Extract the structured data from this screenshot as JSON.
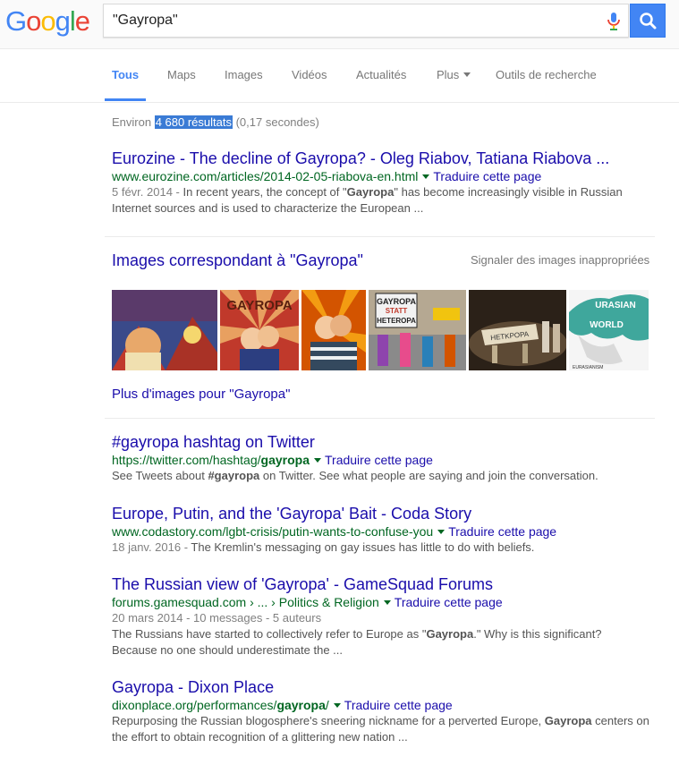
{
  "header": {
    "logo_letters": [
      "G",
      "o",
      "o",
      "g",
      "l",
      "e"
    ],
    "logo_colors": [
      "#4285f4",
      "#ea4335",
      "#fbbc05",
      "#4285f4",
      "#34a853",
      "#ea4335"
    ],
    "query": "\"Gayropa\"",
    "accent": "#4285f4",
    "mic_icon": "microphone-icon",
    "search_icon": "magnifier-icon"
  },
  "tabs": [
    {
      "label": "Tous",
      "active": true
    },
    {
      "label": "Maps"
    },
    {
      "label": "Images"
    },
    {
      "label": "Vidéos"
    },
    {
      "label": "Actualités"
    },
    {
      "label": "Plus"
    },
    {
      "label": "Outils de recherche"
    }
  ],
  "stats": {
    "prefix": "Environ ",
    "highlight": "4 680 résultats",
    "suffix": " (0,17 secondes)"
  },
  "results": [
    {
      "title": "Eurozine - The decline of Gayropa? - Oleg Riabov, Tatiana Riabova ...",
      "url": "www.eurozine.com/articles/2014-02-05-riabova-en.html",
      "translate": "Traduire cette page",
      "date": "5 févr. 2014 - ",
      "snippet_1": "In recent years, the concept of \"",
      "snippet_b": "Gayropa",
      "snippet_2": "\" has become increasingly visible in Russian",
      "snippet_line2": "Internet sources and is used to characterize the European ..."
    },
    {
      "title": "#gayropa hashtag on Twitter",
      "url_pre": "https://twitter.com/hashtag/",
      "url_b": "gayropa",
      "translate": "Traduire cette page",
      "snippet_1": "See Tweets about ",
      "snippet_b": "#gayropa",
      "snippet_2": " on Twitter. See what people are saying and join the conversation."
    },
    {
      "title": "Europe, Putin, and the 'Gayropa' Bait - Coda Story",
      "url": "www.codastory.com/lgbt-crisis/putin-wants-to-confuse-you",
      "translate": "Traduire cette page",
      "date": "18 janv. 2016 - ",
      "snippet": "The Kremlin's messaging on gay issues has little to do with beliefs."
    },
    {
      "title": "The Russian view of 'Gayropa' - GameSquad Forums",
      "url": "forums.gamesquad.com › ... › Politics & Religion",
      "translate": "Traduire cette page",
      "meta": "20 mars 2014 - 10 messages - 5 auteurs",
      "snippet_1": "The Russians have started to collectively refer to Europe as \"",
      "snippet_b": "Gayropa",
      "snippet_2": ".\" Why is this significant?",
      "snippet_line2": "Because no one should underestimate the ..."
    },
    {
      "title": "Gayropa - Dixon Place",
      "url_pre": "dixonplace.org/performances/",
      "url_b": "gayropa",
      "url_post": "/",
      "translate": "Traduire cette page",
      "snippet_1": "Repurposing the Russian blogosphere's sneering nickname for a perverted Europe, ",
      "snippet_b": "Gayropa",
      "snippet_2": " centers on",
      "snippet_line2": "the effort to obtain recognition of a glittering new nation ..."
    }
  ],
  "images": {
    "heading": "Images correspondant à \"Gayropa\"",
    "report": "Signaler des images inappropriées",
    "more": "Plus d'images pour \"Gayropa\"",
    "thumb_texts": {
      "t2": "GAYROPA",
      "t4_a": "GAYROPA",
      "t4_b": "STATT",
      "t4_c": "HETEROPA",
      "t6_a": "URASIAN",
      "t6_b": "WORLD",
      "t6_c": "EURASIANISM"
    }
  }
}
